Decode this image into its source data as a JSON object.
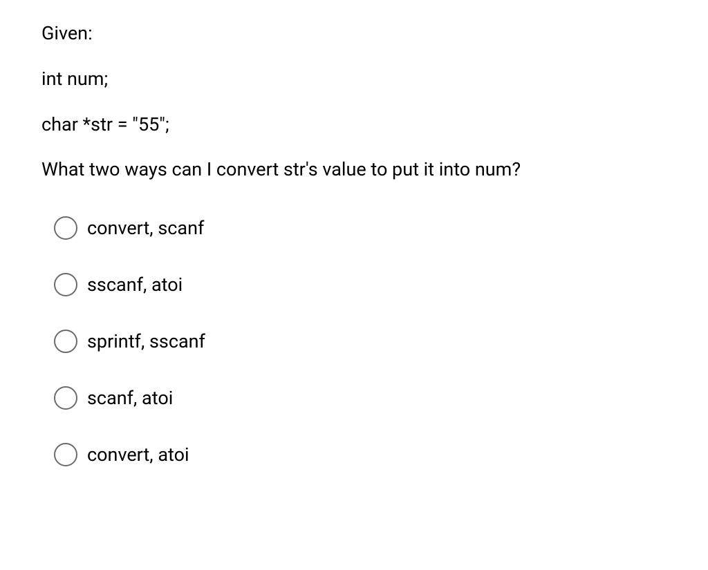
{
  "question": {
    "line1": "Given:",
    "line2": "int num;",
    "line3": "char *str = \"55\";",
    "line4": "What two ways can I convert str's value to put it into num?"
  },
  "options": [
    {
      "label": "convert, scanf"
    },
    {
      "label": "sscanf, atoi"
    },
    {
      "label": "sprintf, sscanf"
    },
    {
      "label": "scanf, atoi"
    },
    {
      "label": "convert, atoi"
    }
  ]
}
